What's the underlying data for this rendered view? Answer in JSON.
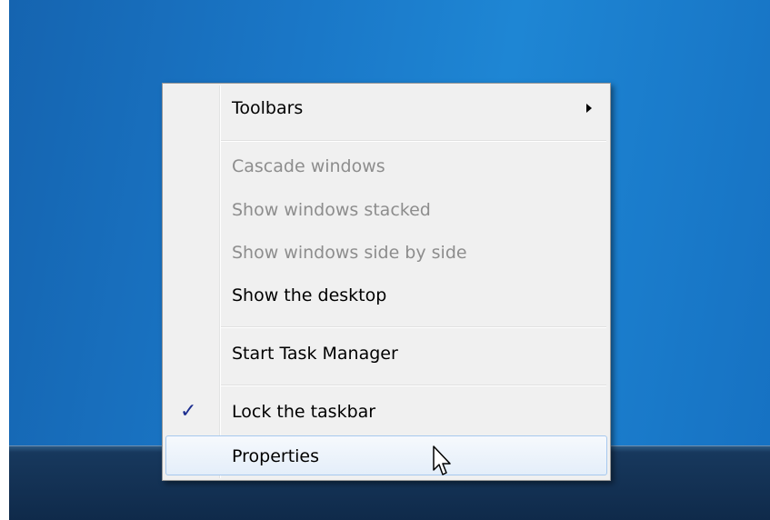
{
  "desktop": {
    "background_colors": [
      "#1564b0",
      "#1e86d4"
    ],
    "taskbar_color": "#0f2a4a"
  },
  "context_menu": {
    "items": [
      {
        "label": "Toolbars",
        "enabled": true,
        "has_submenu": true,
        "submenu_icon": "chevron-right-icon"
      },
      {
        "label": "Cascade windows",
        "enabled": false
      },
      {
        "label": "Show windows stacked",
        "enabled": false
      },
      {
        "label": "Show windows side by side",
        "enabled": false
      },
      {
        "label": "Show the desktop",
        "enabled": true
      },
      {
        "label": "Start Task Manager",
        "enabled": true
      },
      {
        "label": "Lock the taskbar",
        "enabled": true,
        "checked": true,
        "check_glyph": "✓"
      },
      {
        "label": "Properties",
        "enabled": true,
        "hovered": true
      }
    ],
    "colors": {
      "background": "#f0f0f0",
      "disabled_text": "#8d8d8d",
      "hover_border": "#a6c8ee",
      "check": "#1b2d8f"
    }
  },
  "cursor": {
    "icon": "arrow-cursor-icon"
  }
}
